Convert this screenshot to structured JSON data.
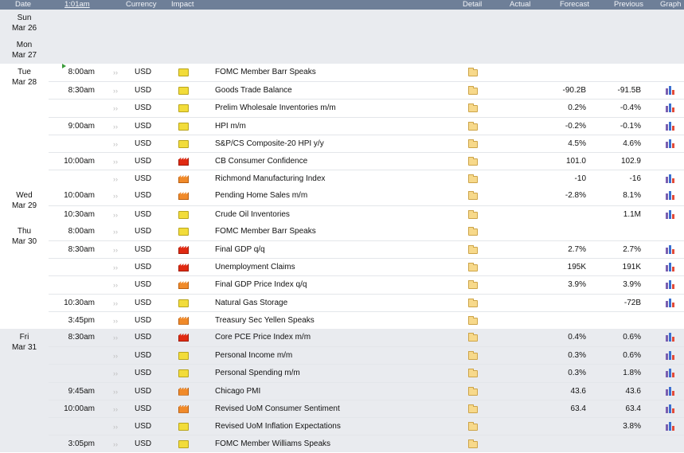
{
  "header": {
    "date": "Date",
    "time": "1:01am",
    "currency": "Currency",
    "impact": "Impact",
    "detail": "Detail",
    "actual": "Actual",
    "forecast": "Forecast",
    "previous": "Previous",
    "graph": "Graph"
  },
  "days": [
    {
      "day": "Sun",
      "date": "Mar 26",
      "events": []
    },
    {
      "day": "Mon",
      "date": "Mar 27",
      "events": []
    },
    {
      "day": "Tue",
      "date": "Mar 28",
      "events": [
        {
          "time": "8:00am",
          "currency": "USD",
          "impact": "low",
          "name": "FOMC Member Barr Speaks",
          "forecast": "",
          "previous": "",
          "graph": false,
          "upnext": true
        },
        {
          "time": "8:30am",
          "currency": "USD",
          "impact": "low",
          "name": "Goods Trade Balance",
          "forecast": "-90.2B",
          "previous": "-91.5B",
          "graph": true
        },
        {
          "time": "",
          "currency": "USD",
          "impact": "low",
          "name": "Prelim Wholesale Inventories m/m",
          "forecast": "0.2%",
          "previous": "-0.4%",
          "graph": true
        },
        {
          "time": "9:00am",
          "currency": "USD",
          "impact": "low",
          "name": "HPI m/m",
          "forecast": "-0.2%",
          "previous": "-0.1%",
          "graph": true
        },
        {
          "time": "",
          "currency": "USD",
          "impact": "low",
          "name": "S&P/CS Composite-20 HPI y/y",
          "forecast": "4.5%",
          "previous": "4.6%",
          "graph": true
        },
        {
          "time": "10:00am",
          "currency": "USD",
          "impact": "high",
          "name": "CB Consumer Confidence",
          "forecast": "101.0",
          "previous": "102.9",
          "graph": false
        },
        {
          "time": "",
          "currency": "USD",
          "impact": "med",
          "name": "Richmond Manufacturing Index",
          "forecast": "-10",
          "previous": "-16",
          "graph": true
        }
      ]
    },
    {
      "day": "Wed",
      "date": "Mar 29",
      "events": [
        {
          "time": "10:00am",
          "currency": "USD",
          "impact": "med",
          "name": "Pending Home Sales m/m",
          "forecast": "-2.8%",
          "previous": "8.1%",
          "graph": true
        },
        {
          "time": "10:30am",
          "currency": "USD",
          "impact": "low",
          "name": "Crude Oil Inventories",
          "forecast": "",
          "previous": "1.1M",
          "graph": true
        }
      ]
    },
    {
      "day": "Thu",
      "date": "Mar 30",
      "events": [
        {
          "time": "8:00am",
          "currency": "USD",
          "impact": "low",
          "name": "FOMC Member Barr Speaks",
          "forecast": "",
          "previous": "",
          "graph": false
        },
        {
          "time": "8:30am",
          "currency": "USD",
          "impact": "high",
          "name": "Final GDP q/q",
          "forecast": "2.7%",
          "previous": "2.7%",
          "graph": true
        },
        {
          "time": "",
          "currency": "USD",
          "impact": "high",
          "name": "Unemployment Claims",
          "forecast": "195K",
          "previous": "191K",
          "graph": true
        },
        {
          "time": "",
          "currency": "USD",
          "impact": "med",
          "name": "Final GDP Price Index q/q",
          "forecast": "3.9%",
          "previous": "3.9%",
          "graph": true
        },
        {
          "time": "10:30am",
          "currency": "USD",
          "impact": "low",
          "name": "Natural Gas Storage",
          "forecast": "",
          "previous": "-72B",
          "graph": true
        },
        {
          "time": "3:45pm",
          "currency": "USD",
          "impact": "med",
          "name": "Treasury Sec Yellen Speaks",
          "forecast": "",
          "previous": "",
          "graph": false
        }
      ]
    },
    {
      "day": "Fri",
      "date": "Mar 31",
      "events": [
        {
          "time": "8:30am",
          "currency": "USD",
          "impact": "high",
          "name": "Core PCE Price Index m/m",
          "forecast": "0.4%",
          "previous": "0.6%",
          "graph": true
        },
        {
          "time": "",
          "currency": "USD",
          "impact": "low",
          "name": "Personal Income m/m",
          "forecast": "0.3%",
          "previous": "0.6%",
          "graph": true
        },
        {
          "time": "",
          "currency": "USD",
          "impact": "low",
          "name": "Personal Spending m/m",
          "forecast": "0.3%",
          "previous": "1.8%",
          "graph": true
        },
        {
          "time": "9:45am",
          "currency": "USD",
          "impact": "med",
          "name": "Chicago PMI",
          "forecast": "43.6",
          "previous": "43.6",
          "graph": true
        },
        {
          "time": "10:00am",
          "currency": "USD",
          "impact": "med",
          "name": "Revised UoM Consumer Sentiment",
          "forecast": "63.4",
          "previous": "63.4",
          "graph": true
        },
        {
          "time": "",
          "currency": "USD",
          "impact": "low",
          "name": "Revised UoM Inflation Expectations",
          "forecast": "",
          "previous": "3.8%",
          "graph": true
        },
        {
          "time": "3:05pm",
          "currency": "USD",
          "impact": "low",
          "name": "FOMC Member Williams Speaks",
          "forecast": "",
          "previous": "",
          "graph": false
        }
      ]
    }
  ]
}
